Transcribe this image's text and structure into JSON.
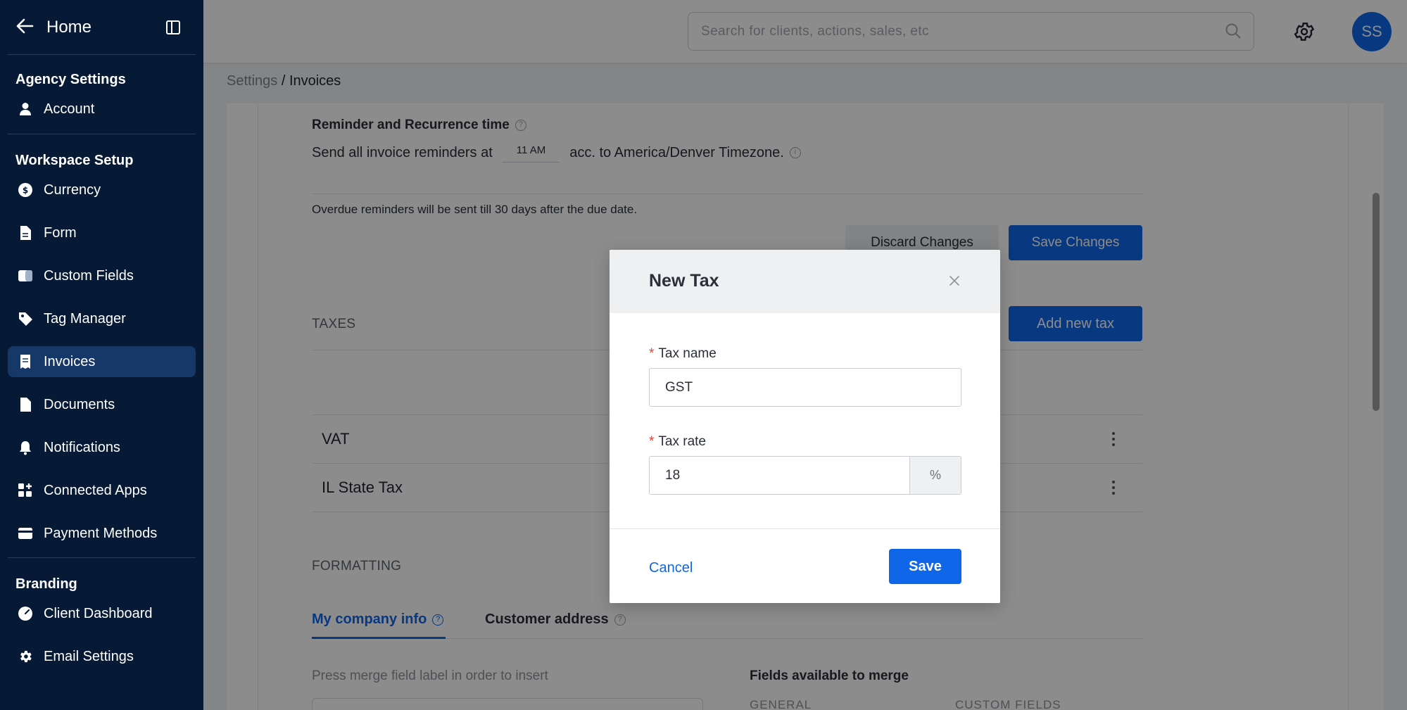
{
  "sidebar": {
    "home_label": "Home",
    "sections": [
      {
        "title": "Agency Settings"
      },
      {
        "title": "Workspace Setup"
      },
      {
        "title": "Branding"
      }
    ],
    "items": [
      {
        "label": "Account",
        "icon": "user-icon"
      },
      {
        "label": "Currency",
        "icon": "dollar-icon"
      },
      {
        "label": "Form",
        "icon": "document-icon"
      },
      {
        "label": "Custom Fields",
        "icon": "toggle-icon"
      },
      {
        "label": "Tag Manager",
        "icon": "tag-icon"
      },
      {
        "label": "Invoices",
        "icon": "invoice-icon",
        "active": true
      },
      {
        "label": "Documents",
        "icon": "file-icon"
      },
      {
        "label": "Notifications",
        "icon": "bell-icon"
      },
      {
        "label": "Connected Apps",
        "icon": "apps-icon"
      },
      {
        "label": "Payment Methods",
        "icon": "card-icon"
      },
      {
        "label": "Client Dashboard",
        "icon": "dashboard-icon"
      },
      {
        "label": "Email Settings",
        "icon": "gear-icon"
      }
    ]
  },
  "topbar": {
    "search_placeholder": "Search for clients, actions, sales, etc",
    "avatar_initials": "SS"
  },
  "breadcrumb": {
    "parent": "Settings",
    "separator": " / ",
    "current": "Invoices"
  },
  "page": {
    "reminder_title": "Reminder and Recurrence time",
    "reminder_prefix": "Send all invoice reminders at",
    "reminder_time": "11 AM",
    "reminder_suffix": "acc. to America/Denver Timezone.",
    "overdue_note": "Overdue reminders will be sent till 30 days after the due date.",
    "discard_label": "Discard Changes",
    "save_changes_label": "Save Changes",
    "taxes_title": "TAXES",
    "add_tax_label": "Add new tax",
    "tax_rows": [
      {
        "name": "VAT"
      },
      {
        "name": "IL State Tax"
      }
    ],
    "formatting_title": "FORMATTING",
    "tabs": [
      {
        "label": "My company info",
        "active": true
      },
      {
        "label": "Customer address"
      }
    ],
    "merge_hint": "Press merge field label in order to insert",
    "fields_title": "Fields available to merge",
    "general_label": "GENERAL",
    "custom_fields_label": "CUSTOM FIELDS"
  },
  "modal": {
    "title": "New Tax",
    "tax_name_label": "Tax name",
    "tax_name_value": "GST",
    "tax_rate_label": "Tax rate",
    "tax_rate_value": "18",
    "tax_rate_suffix": "%",
    "required_marker": "*",
    "cancel_label": "Cancel",
    "save_label": "Save"
  },
  "colors": {
    "primary": "#0f66e9",
    "sidebar_bg": "#061935",
    "sidebar_active": "#163868",
    "required": "#e0443a"
  }
}
